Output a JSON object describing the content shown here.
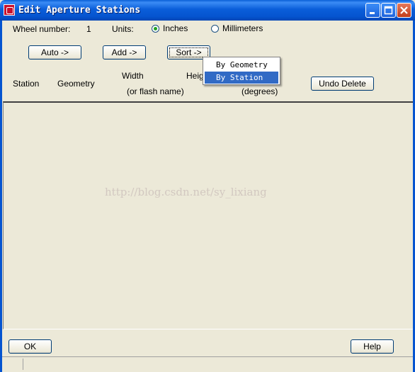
{
  "window": {
    "title": "Edit Aperture Stations",
    "controls": {
      "minimize": "minimize-icon",
      "maximize": "maximize-icon",
      "close": "close-icon"
    }
  },
  "header": {
    "wheel_label": "Wheel number:",
    "wheel_value": "1",
    "units_label": "Units:",
    "units_options": [
      {
        "label": "Inches",
        "selected": true
      },
      {
        "label": "Millimeters",
        "selected": false
      }
    ]
  },
  "toolbar": {
    "auto_label": "Auto ->",
    "add_label": "Add ->",
    "sort_label": "Sort ->",
    "undo_label": "Undo Delete"
  },
  "columns": {
    "station": "Station",
    "geometry": "Geometry",
    "width": "Width",
    "width_sub": "(or flash name)",
    "height": "Heig",
    "rotation_sub": "(degrees)"
  },
  "sort_menu": {
    "items": [
      "By Geometry",
      "By Station"
    ],
    "highlighted": "By Station"
  },
  "watermark": "http://blog.csdn.net/sy_lixiang",
  "footer": {
    "ok_label": "OK",
    "help_label": "Help"
  },
  "colors": {
    "titlebar": "#0554d0",
    "dialog_bg": "#ece9d8",
    "menu_highlight": "#316ac5"
  }
}
